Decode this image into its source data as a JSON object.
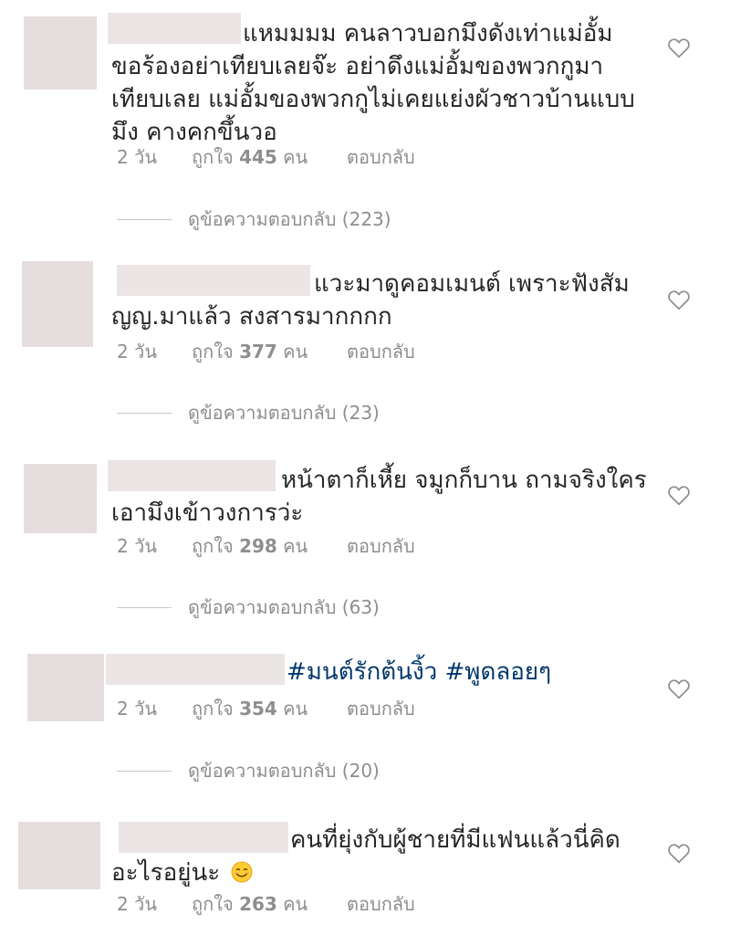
{
  "comments": [
    {
      "text_lines": [
        "แหมมมม คนลาวบอกมึงดังเท่าแม่อั้ม",
        "ขอร้องอย่าเทียบเลยจ๊ะ อย่าดึงแม่อั้มของพวกกูมา",
        "เทียบเลย แม่อั้มของพวกกูไม่เคยแย่งผัวชาวบ้านแบบ",
        "มึง คางคกขึ้นวอ"
      ],
      "time": "2 วัน",
      "likes_prefix": "ถูกใจ",
      "likes_count": "445",
      "likes_suffix": "คน",
      "reply": "ตอบกลับ",
      "view_replies": "ดูข้อความตอบกลับ (223)"
    },
    {
      "text_lines": [
        "แวะมาดูคอมเมนต์ เพราะฟังสัม",
        "ญญ.มาแล้ว สงสารมากกกก"
      ],
      "time": "2 วัน",
      "likes_prefix": "ถูกใจ",
      "likes_count": "377",
      "likes_suffix": "คน",
      "reply": "ตอบกลับ",
      "view_replies": "ดูข้อความตอบกลับ (23)"
    },
    {
      "text_lines": [
        "หน้าตาก็เหี้ย จมูกก็บาน ถามจริงใคร",
        "เอามึงเข้าวงการว่ะ"
      ],
      "time": "2 วัน",
      "likes_prefix": "ถูกใจ",
      "likes_count": "298",
      "likes_suffix": "คน",
      "reply": "ตอบกลับ",
      "view_replies": "ดูข้อความตอบกลับ (63)"
    },
    {
      "hashtags": [
        "#มนต์รักต้นงิ้ว",
        "#พูดลอยๆ"
      ],
      "time": "2 วัน",
      "likes_prefix": "ถูกใจ",
      "likes_count": "354",
      "likes_suffix": "คน",
      "reply": "ตอบกลับ",
      "view_replies": "ดูข้อความตอบกลับ (20)"
    },
    {
      "text_lines": [
        "คนที่ยุ่งกับผู้ชายที่มีแฟนแล้วนี่คิด",
        "อะไรอยู่นะ"
      ],
      "emoji": "smiling-face-emoji",
      "time": "2 วัน",
      "likes_prefix": "ถูกใจ",
      "likes_count": "263",
      "likes_suffix": "คน",
      "reply": "ตอบกลับ"
    }
  ],
  "icons": {
    "like": "heart-outline-icon"
  },
  "colors": {
    "text": "#262626",
    "meta": "#8e8e8e",
    "hashtag": "#00376b",
    "mask": "#ece5e5"
  }
}
